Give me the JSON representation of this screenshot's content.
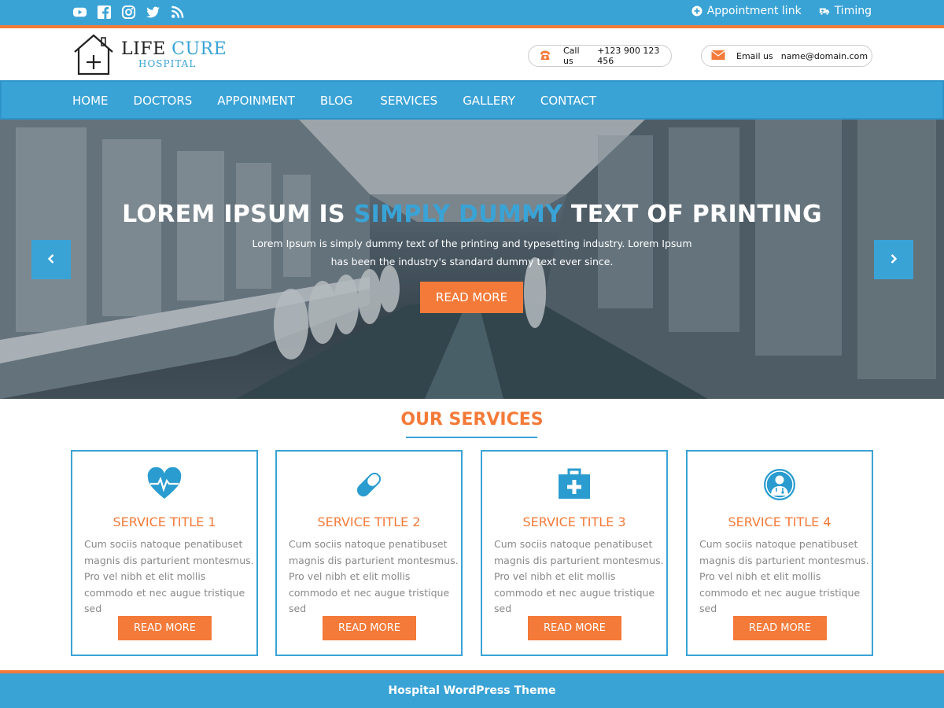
{
  "topbar": {
    "social_icons": [
      "youtube-icon",
      "facebook-icon",
      "instagram-icon",
      "twitter-icon",
      "rss-icon"
    ],
    "appointment_label": "Appointment link",
    "timing_label": "Timing"
  },
  "header": {
    "logo": {
      "word1": "LIFE",
      "word2": "CURE",
      "sub": "HOSPITAL"
    },
    "call": {
      "label": "Call us",
      "value": "+123 900 123 456"
    },
    "email": {
      "label": "Email us",
      "value": "name@domain.com"
    }
  },
  "nav": {
    "items": [
      "HOME",
      "DOCTORS",
      "APPOINMENT",
      "BLOG",
      "SERVICES",
      "GALLERY",
      "CONTACT"
    ]
  },
  "hero": {
    "title_part1": "LOREM IPSUM IS ",
    "title_highlight": "SIMPLY DUMMY",
    "title_part2": " TEXT OF PRINTING",
    "subtitle": "Lorem Ipsum is simply dummy text of the printing and typesetting industry. Lorem Ipsum has been the industry's standard dummy text ever since.",
    "button": "READ MORE"
  },
  "services": {
    "heading": "OUR SERVICES",
    "cards": [
      {
        "icon": "heartbeat-icon",
        "title": "SERVICE TITLE 1",
        "text": "Cum sociis natoque penatibuset magnis dis parturient montesmus. Pro vel nibh et elit mollis commodo et nec augue tristique sed",
        "button": "READ MORE"
      },
      {
        "icon": "pill-icon",
        "title": "SERVICE TITLE 2",
        "text": "Cum sociis natoque penatibuset magnis dis parturient montesmus. Pro vel nibh et elit mollis commodo et nec augue tristique sed",
        "button": "READ MORE"
      },
      {
        "icon": "first-aid-kit-icon",
        "title": "SERVICE TITLE 3",
        "text": "Cum sociis natoque penatibuset magnis dis parturient montesmus. Pro vel nibh et elit mollis commodo et nec augue tristique sed",
        "button": "READ MORE"
      },
      {
        "icon": "doctor-icon",
        "title": "SERVICE TITLE 4",
        "text": "Cum sociis natoque penatibuset magnis dis parturient montesmus. Pro vel nibh et elit mollis commodo et nec augue tristique sed",
        "button": "READ MORE"
      }
    ]
  },
  "footer": {
    "text": "Hospital WordPress Theme"
  },
  "colors": {
    "primary": "#3aa3d6",
    "accent": "#f47a39",
    "text_muted": "#888888"
  }
}
